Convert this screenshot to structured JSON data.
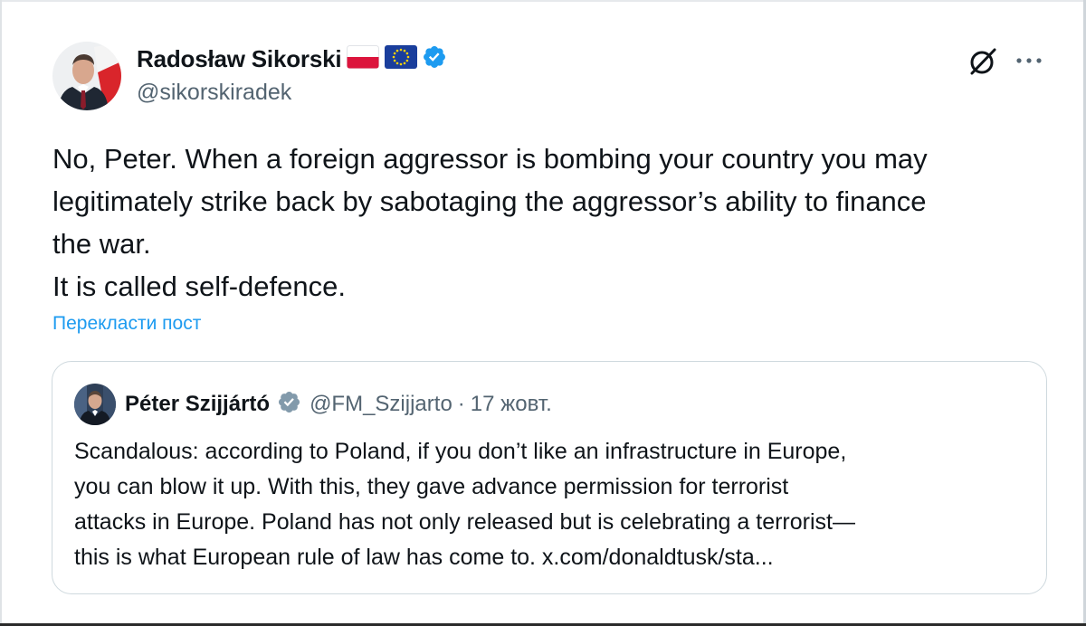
{
  "author": {
    "name": "Radosław Sikorski",
    "handle": "@sikorskiradek",
    "flags": [
      "poland-flag",
      "eu-flag"
    ],
    "verified": true
  },
  "actions": {
    "grok_icon": "grok-icon",
    "more_icon": "more-icon"
  },
  "post": {
    "lines": [
      "No, Peter. When a foreign aggressor is bombing your country you may",
      "legitimately strike back by sabotaging the aggressor’s ability to finance",
      "the war.",
      "It is called self-defence."
    ]
  },
  "translate_label": "Перекласти пост",
  "quote": {
    "name": "Péter Szijjártó",
    "handle": "@FM_Szijjarto",
    "separator": "·",
    "date": "17 жовт.",
    "verified": true,
    "verified_color": "#829aab",
    "lines": [
      "Scandalous: according to Poland, if you don’t like an infrastructure in Europe,",
      "you can blow it up. With this, they gave advance permission for terrorist",
      "attacks in Europe. Poland has not only released but is celebrating a terrorist—",
      "this is what European rule of law has come to. x.com/donaldtusk/sta..."
    ]
  },
  "colors": {
    "verified_blue": "#1d9bf0",
    "link_blue": "#1d9bf0",
    "text": "#0f1419",
    "secondary": "#536471"
  }
}
